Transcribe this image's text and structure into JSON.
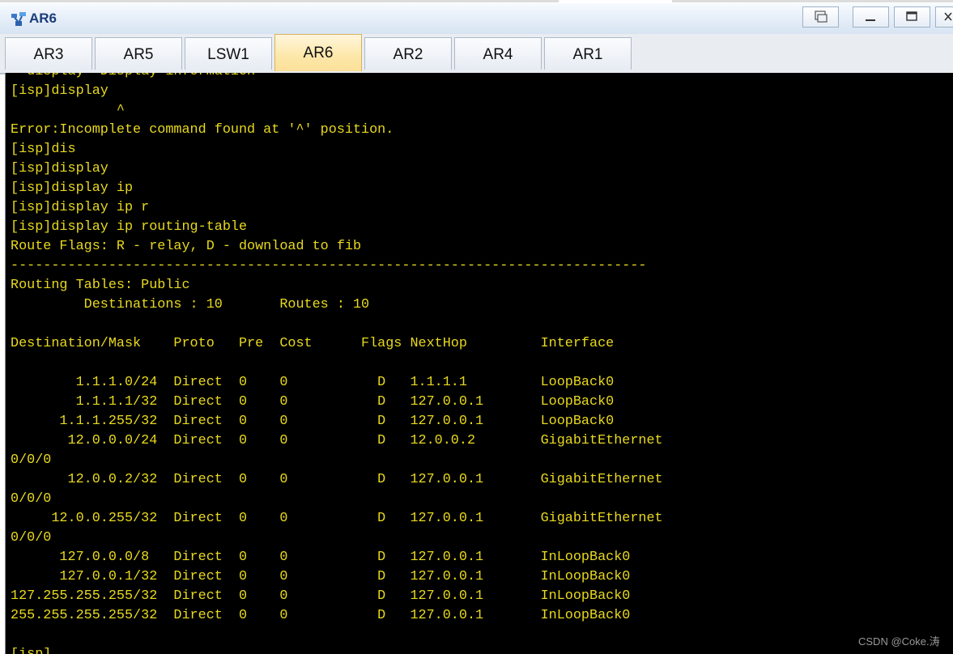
{
  "window": {
    "title": "AR6"
  },
  "tabs": [
    {
      "label": "AR3"
    },
    {
      "label": "AR5"
    },
    {
      "label": "LSW1"
    },
    {
      "label": "AR6",
      "active": true
    },
    {
      "label": "AR2"
    },
    {
      "label": "AR4"
    },
    {
      "label": "AR1"
    }
  ],
  "console": {
    "text_color": "#e8d91e",
    "background": "#000000",
    "lines": [
      "  display  Display information",
      "[isp]display",
      "             ^",
      "Error:Incomplete command found at '^' position.",
      "[isp]dis",
      "[isp]display",
      "[isp]display ip",
      "[isp]display ip r",
      "[isp]display ip routing-table",
      "Route Flags: R - relay, D - download to fib",
      "------------------------------------------------------------------------------",
      "Routing Tables: Public",
      "         Destinations : 10       Routes : 10",
      "",
      "Destination/Mask    Proto   Pre  Cost      Flags NextHop         Interface",
      "",
      "        1.1.1.0/24  Direct  0    0           D   1.1.1.1         LoopBack0",
      "        1.1.1.1/32  Direct  0    0           D   127.0.0.1       LoopBack0",
      "      1.1.1.255/32  Direct  0    0           D   127.0.0.1       LoopBack0",
      "       12.0.0.0/24  Direct  0    0           D   12.0.0.2        GigabitEthernet",
      "0/0/0",
      "       12.0.0.2/32  Direct  0    0           D   127.0.0.1       GigabitEthernet",
      "0/0/0",
      "     12.0.0.255/32  Direct  0    0           D   127.0.0.1       GigabitEthernet",
      "0/0/0",
      "      127.0.0.0/8   Direct  0    0           D   127.0.0.1       InLoopBack0",
      "      127.0.0.1/32  Direct  0    0           D   127.0.0.1       InLoopBack0",
      "127.255.255.255/32  Direct  0    0           D   127.0.0.1       InLoopBack0",
      "255.255.255.255/32  Direct  0    0           D   127.0.0.1       InLoopBack0",
      "",
      "[isp]"
    ]
  },
  "watermark": "CSDN @Coke.涛"
}
